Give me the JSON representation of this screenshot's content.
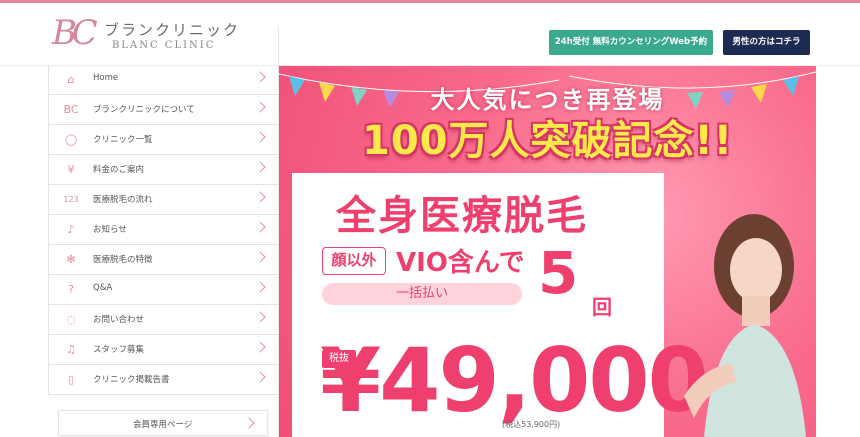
{
  "header": {
    "logo_mark": "BC",
    "logo_jp": "ブランクリニック",
    "logo_en": "BLANC CLINIC",
    "consult_button": "24h受付 無料カウンセリングWeb予約",
    "men_button": "男性の方はコチラ"
  },
  "sidebar": {
    "items": [
      {
        "icon": "home-icon",
        "glyph": "⌂",
        "label": "Home"
      },
      {
        "icon": "bc-logo-icon",
        "glyph": "BC",
        "label": "ブランクリニックについて"
      },
      {
        "icon": "map-pin-icon",
        "glyph": "◯",
        "label": "クリニック一覧"
      },
      {
        "icon": "yen-icon",
        "glyph": "¥",
        "label": "料金のご案内"
      },
      {
        "icon": "steps-icon",
        "glyph": "123",
        "label": "医療脱毛の流れ"
      },
      {
        "icon": "bell-icon",
        "glyph": "♪",
        "label": "お知らせ"
      },
      {
        "icon": "sparkle-icon",
        "glyph": "✻",
        "label": "医療脱毛の特徴"
      },
      {
        "icon": "question-icon",
        "glyph": "?",
        "label": "Q&A"
      },
      {
        "icon": "chat-icon",
        "glyph": "◌",
        "label": "お問い合わせ"
      },
      {
        "icon": "music-note-icon",
        "glyph": "♫",
        "label": "スタッフ募集"
      },
      {
        "icon": "document-icon",
        "glyph": "▯",
        "label": "クリニック掲載告書"
      }
    ],
    "member_button": "会員専用ページ"
  },
  "hero": {
    "catch_top": "大人気につき再登場",
    "catch_main": "100万人突破記念!!",
    "title": "全身医療脱毛",
    "face_tag": "顔以外",
    "vio_text": "VIO含んで",
    "lump_sum": "一括払い",
    "times_number": "5",
    "times_unit": "回",
    "tax_badge": "税抜",
    "price": "¥49,000",
    "price_note": "(税込53,900円)"
  },
  "colors": {
    "brand_pink": "#ef3f6e",
    "accent_green": "#3aa98e",
    "navy": "#1d2a52",
    "highlight_yellow": "#ffe94a"
  }
}
